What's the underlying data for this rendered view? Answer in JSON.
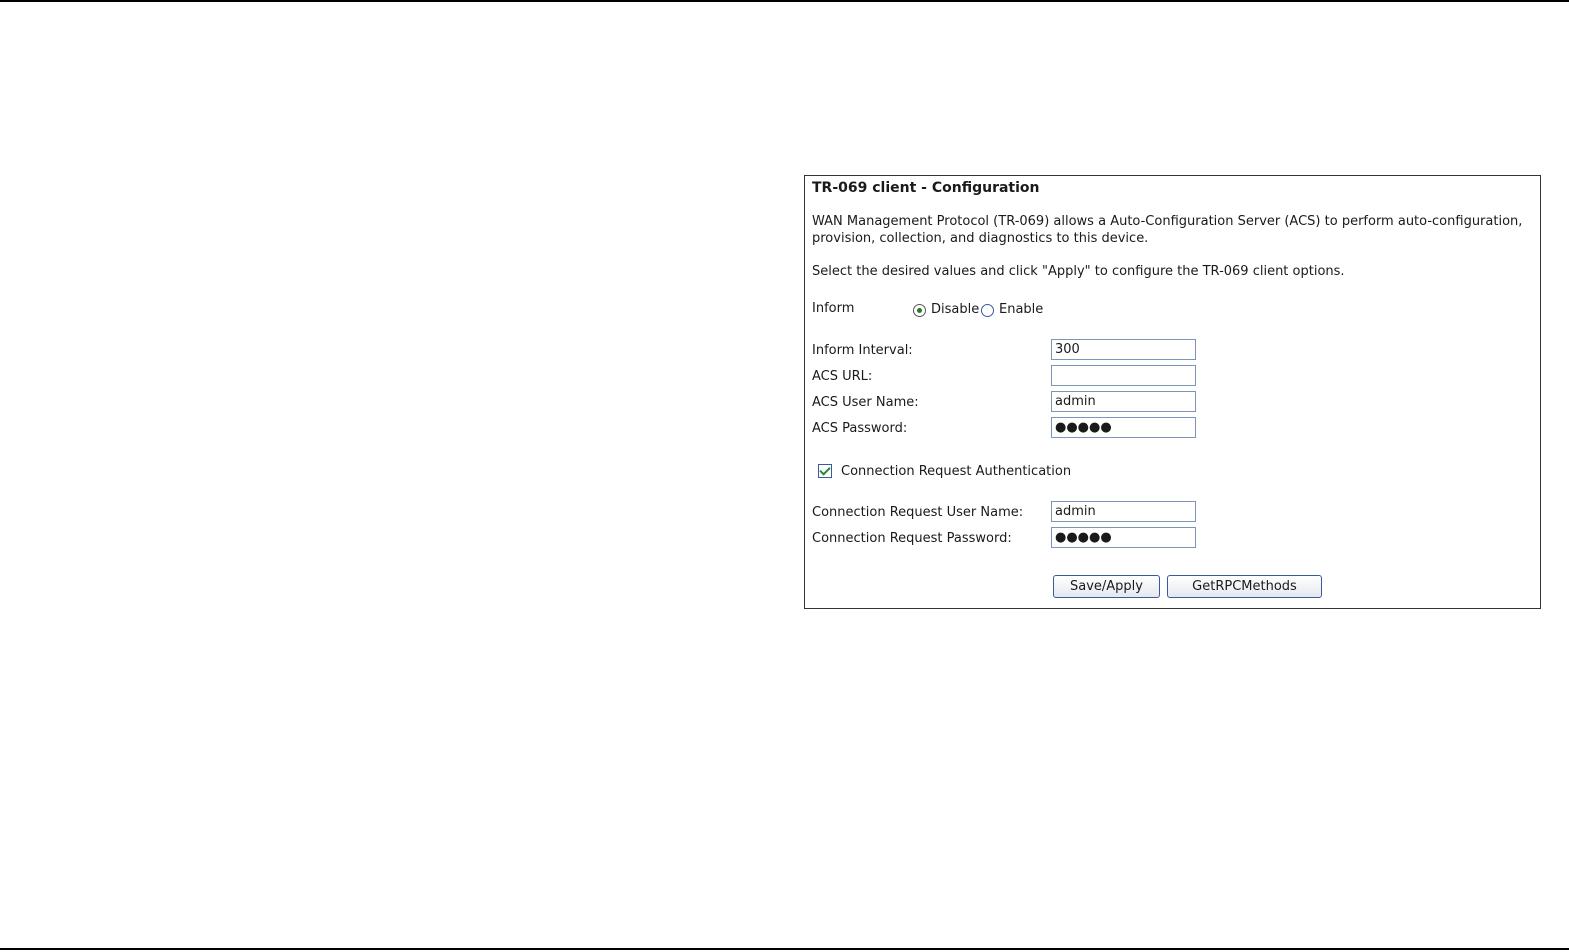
{
  "panel": {
    "title": "TR-069 client - Configuration",
    "description_line1": "WAN Management Protocol (TR-069) allows a Auto-Configuration Server (ACS) to perform auto-configuration,",
    "description_line2": "provision, collection, and diagnostics to this device.",
    "instruction": "Select the desired values and click \"Apply\" to configure the TR-069 client options."
  },
  "inform": {
    "label": "Inform",
    "options": [
      {
        "label": "Disable",
        "selected": true
      },
      {
        "label": "Enable",
        "selected": false
      }
    ]
  },
  "fields": {
    "inform_interval": {
      "label": "Inform Interval:",
      "value": "300"
    },
    "acs_url": {
      "label": "ACS URL:",
      "value": ""
    },
    "acs_user_name": {
      "label": "ACS User Name:",
      "value": "admin"
    },
    "acs_password": {
      "label": "ACS Password:",
      "value": "●●●●●"
    }
  },
  "conn_auth": {
    "label": "Connection Request Authentication",
    "checked": true
  },
  "conn_fields": {
    "user_name": {
      "label": "Connection Request User Name:",
      "value": "admin"
    },
    "password": {
      "label": "Connection Request Password:",
      "value": "●●●●●"
    }
  },
  "buttons": {
    "save_apply": "Save/Apply",
    "get_rpc_methods": "GetRPCMethods"
  }
}
